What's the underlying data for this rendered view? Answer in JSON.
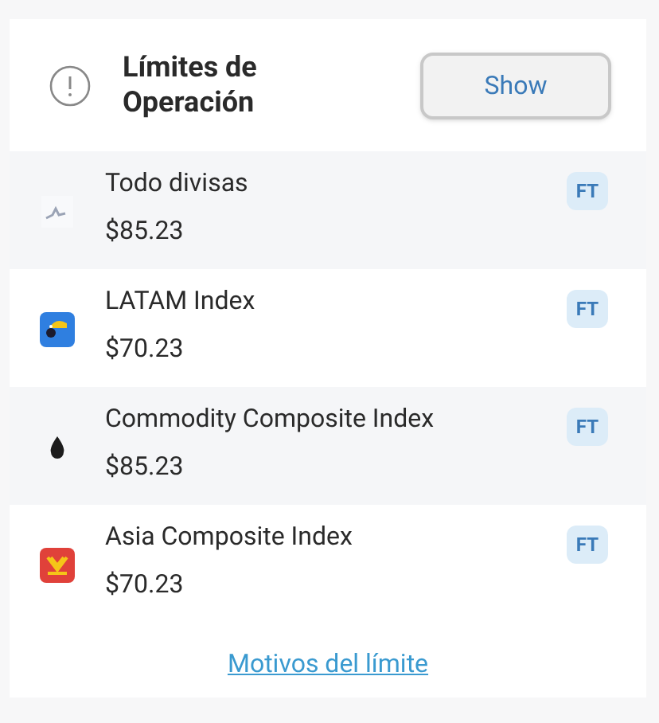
{
  "header": {
    "title": "Límites de Operación",
    "button": "Show"
  },
  "items": [
    {
      "name": "Todo divisas",
      "price": "$85.23",
      "badge": "FT",
      "kind": "chart"
    },
    {
      "name": "LATAM Index",
      "price": "$70.23",
      "badge": "FT",
      "kind": "bird"
    },
    {
      "name": "Commodity Composite Index",
      "price": "$85.23",
      "badge": "FT",
      "kind": "drop"
    },
    {
      "name": "Asia Composite Index",
      "price": "$70.23",
      "badge": "FT",
      "kind": "emblem"
    }
  ],
  "link": "Motivos del límite"
}
